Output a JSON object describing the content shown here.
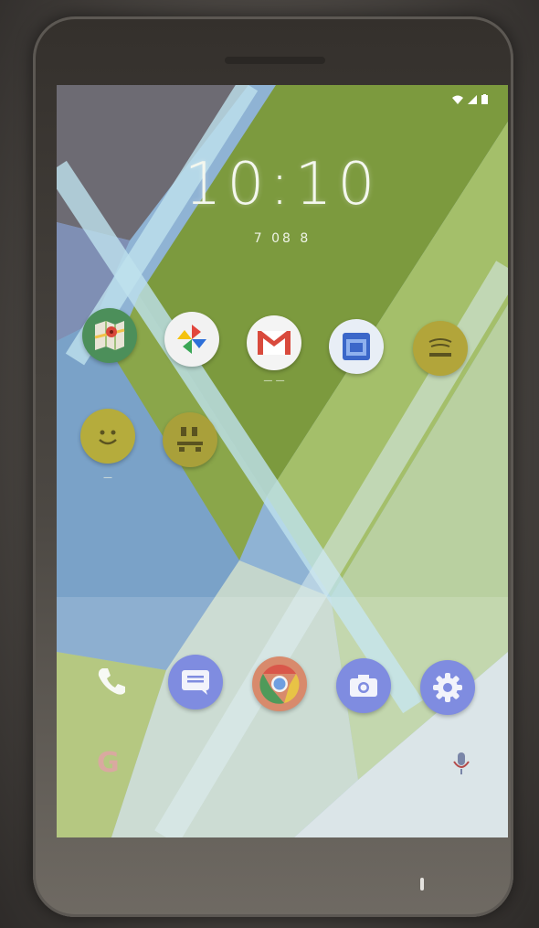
{
  "lock_screen": {
    "time": "10:10",
    "date": "7 08 8"
  },
  "home_apps": [
    {
      "name": "Maps",
      "icon": "maps-icon",
      "color": "#4c8f5a"
    },
    {
      "name": "Photos",
      "icon": "pinwheel-icon",
      "color": "#f2f2f2"
    },
    {
      "name": "Gmail",
      "icon": "gmail-icon",
      "color": "#f4f4f4"
    },
    {
      "name": "Calendar",
      "icon": "calendar-icon",
      "color": "#e8eef6"
    },
    {
      "name": "App",
      "icon": "tray-icon",
      "color": "#b2a53a"
    },
    {
      "name": "Smiley",
      "icon": "smiley-icon",
      "color": "#b5ac3c"
    },
    {
      "name": "Tools",
      "icon": "toolbox-icon",
      "color": "#a9a03a"
    }
  ],
  "app_labels": {
    "gmail": "— —",
    "smiley": "—"
  },
  "dock": [
    {
      "name": "Phone",
      "icon": "phone-icon"
    },
    {
      "name": "Messages",
      "icon": "message-icon",
      "color": "#7f8ce0"
    },
    {
      "name": "Chrome",
      "icon": "chrome-icon",
      "color": "#d88a6c"
    },
    {
      "name": "Camera",
      "icon": "camera-icon",
      "color": "#7f8ce0"
    },
    {
      "name": "Settings",
      "icon": "settings-icon",
      "color": "#7f8ce0"
    }
  ],
  "search": {
    "logo": "G",
    "mic_icon": "mic-icon"
  }
}
